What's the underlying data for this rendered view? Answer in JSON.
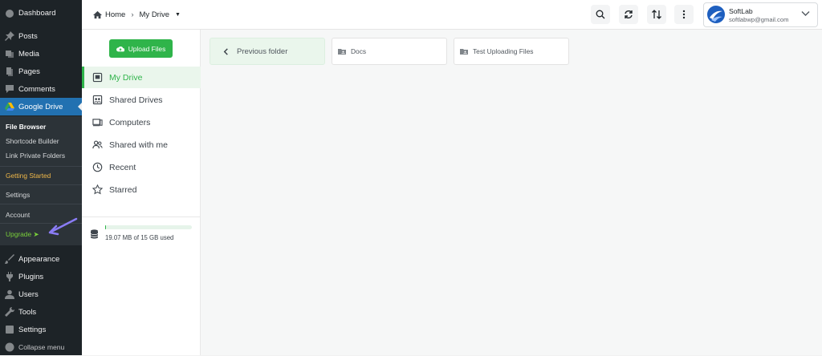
{
  "wp_sidebar": {
    "top_items": [
      {
        "label": "Dashboard",
        "icon": "dashboard-icon"
      },
      {
        "label": "Posts",
        "icon": "pin-icon"
      },
      {
        "label": "Media",
        "icon": "media-icon"
      },
      {
        "label": "Pages",
        "icon": "pages-icon"
      },
      {
        "label": "Comments",
        "icon": "comment-icon"
      },
      {
        "label": "Google Drive",
        "icon": "google-drive-icon"
      }
    ],
    "submenu": {
      "file_browser": "File Browser",
      "shortcode_builder": "Shortcode Builder",
      "link_private_folders": "Link Private Folders",
      "getting_started": "Getting Started",
      "settings": "Settings",
      "account": "Account",
      "upgrade": "Upgrade"
    },
    "bottom_items": [
      {
        "label": "Appearance",
        "icon": "paintbrush-icon"
      },
      {
        "label": "Plugins",
        "icon": "plugin-icon"
      },
      {
        "label": "Users",
        "icon": "users-icon"
      },
      {
        "label": "Tools",
        "icon": "wrench-icon"
      },
      {
        "label": "Settings",
        "icon": "settings-icon"
      },
      {
        "label": "Collapse menu",
        "icon": "collapse-icon"
      }
    ],
    "active_color": "#2271b1"
  },
  "breadcrumb": {
    "home": "Home",
    "current": "My Drive"
  },
  "user": {
    "name": "SoftLab",
    "email": "softlabwp@gmail.com"
  },
  "upload_label": "Upload Files",
  "nav": [
    {
      "label": "My Drive",
      "icon": "drive-icon"
    },
    {
      "label": "Shared Drives",
      "icon": "shared-drives-icon"
    },
    {
      "label": "Computers",
      "icon": "computer-icon"
    },
    {
      "label": "Shared with me",
      "icon": "people-icon"
    },
    {
      "label": "Recent",
      "icon": "clock-icon"
    },
    {
      "label": "Starred",
      "icon": "star-icon"
    }
  ],
  "storage": {
    "text": "19.07 MB of 15 GB used",
    "used_fraction": 0.0013
  },
  "folders": {
    "previous": "Previous folder",
    "items": [
      "Docs",
      "Test Uploading Files"
    ]
  },
  "accent": "#2fb44a"
}
